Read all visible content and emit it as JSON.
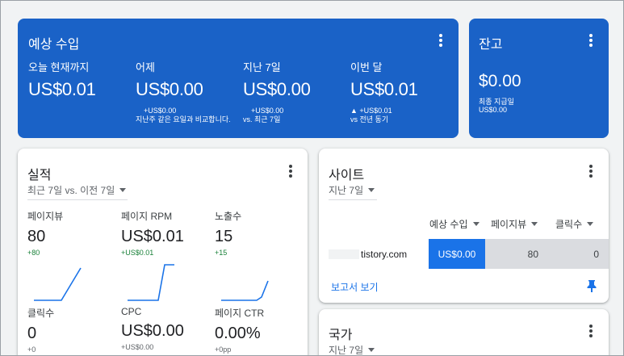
{
  "estimated_earnings": {
    "title": "예상 수입",
    "metrics": [
      {
        "label": "오늘 현재까지",
        "value": "US$0.01",
        "compare_amount": "",
        "compare_text": ""
      },
      {
        "label": "어제",
        "value": "US$0.00",
        "compare_amount": "+US$0.00",
        "compare_text": "지난주 같은 요일과 비교합니다."
      },
      {
        "label": "지난 7일",
        "value": "US$0.00",
        "compare_amount": "+US$0.00",
        "compare_text": "vs. 최근 7일"
      },
      {
        "label": "이번 달",
        "value": "US$0.01",
        "compare_amount": "▲ +US$0.01",
        "compare_text": "vs 전년 동기"
      }
    ]
  },
  "balance": {
    "title": "잔고",
    "value": "$0.00",
    "last_payment_label": "최종 지급일",
    "last_payment_value": "US$0.00"
  },
  "performance": {
    "title": "실적",
    "period": "최근 7일 vs. 이전 7일",
    "metrics": [
      {
        "label": "페이지뷰",
        "value": "80",
        "change": "+80",
        "trend": "up"
      },
      {
        "label": "페이지 RPM",
        "value": "US$0.01",
        "change": "+US$0.01",
        "trend": "up"
      },
      {
        "label": "노출수",
        "value": "15",
        "change": "+15",
        "trend": "up"
      },
      {
        "label": "클릭수",
        "value": "0",
        "change": "+0",
        "trend": "flat"
      },
      {
        "label": "CPC",
        "value": "US$0.00",
        "change": "+US$0.00",
        "trend": "flat"
      },
      {
        "label": "페이지 CTR",
        "value": "0.00%",
        "change": "+0pp",
        "trend": "flat"
      }
    ]
  },
  "sites": {
    "title": "사이트",
    "period": "지난 7일",
    "columns": [
      "예상 수입",
      "페이지뷰",
      "클릭수"
    ],
    "rows": [
      {
        "site": "tistory.com",
        "earnings": "US$0.00",
        "pageviews": "80",
        "clicks": "0"
      }
    ],
    "report_link": "보고서 보기",
    "colors": {
      "highlight": "#1a73e8",
      "bar": "#dadce0"
    }
  },
  "countries": {
    "title": "국가",
    "period": "지난 7일"
  },
  "colors": {
    "card_blue": "#1a62c7",
    "positive": "#188038"
  }
}
